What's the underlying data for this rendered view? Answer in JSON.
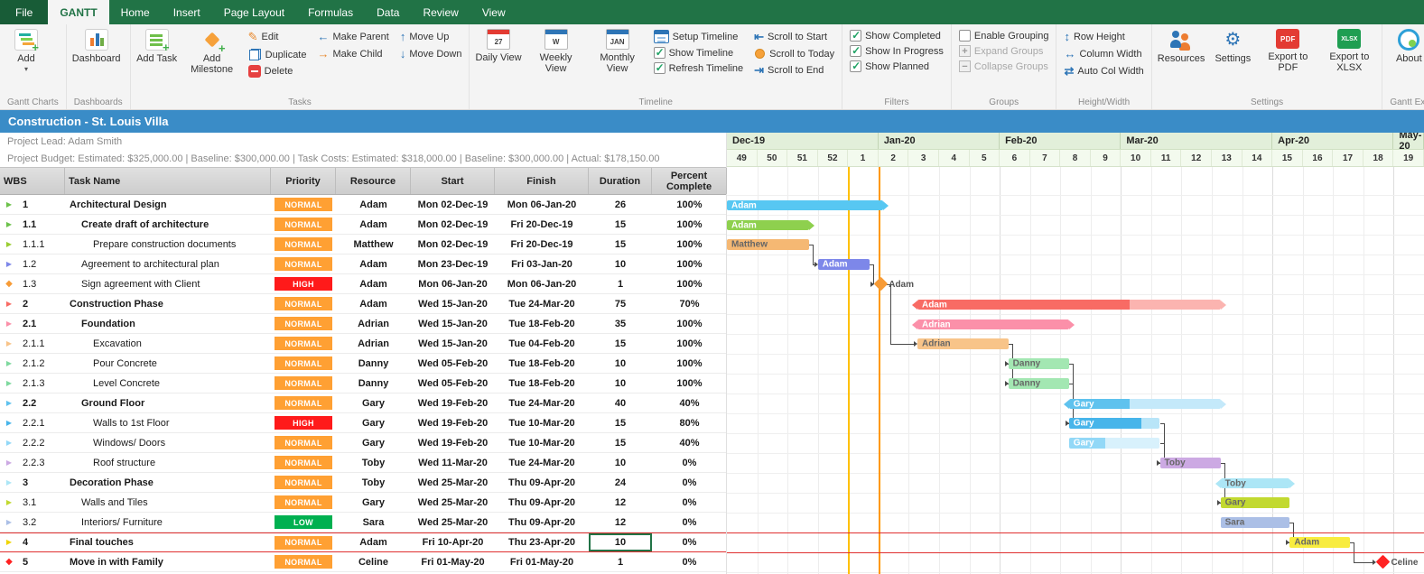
{
  "ribbon": {
    "tabs": [
      {
        "label": "File",
        "file": true
      },
      {
        "label": "GANTT",
        "active": true
      },
      {
        "label": "Home"
      },
      {
        "label": "Insert"
      },
      {
        "label": "Page Layout"
      },
      {
        "label": "Formulas"
      },
      {
        "label": "Data"
      },
      {
        "label": "Review"
      },
      {
        "label": "View"
      }
    ],
    "groups": [
      {
        "label": "Gantt Charts",
        "items": [
          {
            "type": "big",
            "label": "Add",
            "icon": "gantt-add",
            "dropdown": true
          }
        ]
      },
      {
        "label": "Dashboards",
        "items": [
          {
            "type": "big",
            "label": "Dashboard",
            "icon": "dashboard"
          }
        ]
      },
      {
        "label": "Tasks",
        "items": [
          {
            "type": "big",
            "label": "Add Task",
            "icon": "add-task"
          },
          {
            "type": "big",
            "label": "Add Milestone",
            "icon": "add-milestone"
          },
          {
            "type": "col",
            "items": [
              {
                "label": "Edit",
                "icon": "edit"
              },
              {
                "label": "Duplicate",
                "icon": "duplicate"
              },
              {
                "label": "Delete",
                "icon": "delete"
              }
            ]
          },
          {
            "type": "col",
            "items": [
              {
                "label": "Make Parent",
                "icon": "make-parent"
              },
              {
                "label": "Make Child",
                "icon": "make-child"
              }
            ]
          },
          {
            "type": "col",
            "items": [
              {
                "label": "Move Up",
                "icon": "move-up"
              },
              {
                "label": "Move Down",
                "icon": "move-down"
              }
            ]
          }
        ]
      },
      {
        "label": "Timeline",
        "items": [
          {
            "type": "big",
            "label": "Daily View",
            "icon": "cal-daily",
            "icon_text": "27"
          },
          {
            "type": "big",
            "label": "Weekly View",
            "icon": "cal-weekly",
            "icon_text": "W"
          },
          {
            "type": "big",
            "label": "Monthly View",
            "icon": "cal-monthly",
            "icon_text": "JAN"
          },
          {
            "type": "col",
            "items": [
              {
                "label": "Setup Timeline",
                "icon": "setup-timeline"
              },
              {
                "label": "Show Timeline",
                "icon": "check-on"
              },
              {
                "label": "Refresh Timeline",
                "icon": "check-on"
              }
            ]
          },
          {
            "type": "col",
            "items": [
              {
                "label": "Scroll to Start",
                "icon": "scroll-start"
              },
              {
                "label": "Scroll to Today",
                "icon": "scroll-today"
              },
              {
                "label": "Scroll to End",
                "icon": "scroll-end"
              }
            ]
          }
        ]
      },
      {
        "label": "Filters",
        "items": [
          {
            "type": "col",
            "items": [
              {
                "label": "Show Completed",
                "icon": "check-on"
              },
              {
                "label": "Show In Progress",
                "icon": "check-on"
              },
              {
                "label": "Show Planned",
                "icon": "check-on"
              }
            ]
          }
        ]
      },
      {
        "label": "Groups",
        "items": [
          {
            "type": "col",
            "items": [
              {
                "label": "Enable Grouping",
                "icon": "check-off"
              },
              {
                "label": "Expand Groups",
                "icon": "expand",
                "disabled": true
              },
              {
                "label": "Collapse Groups",
                "icon": "collapse",
                "disabled": true
              }
            ]
          }
        ]
      },
      {
        "label": "Height/Width",
        "items": [
          {
            "type": "col",
            "items": [
              {
                "label": "Row Height",
                "icon": "row-height"
              },
              {
                "label": "Column Width",
                "icon": "col-width"
              },
              {
                "label": "Auto Col Width",
                "icon": "auto-col"
              }
            ]
          }
        ]
      },
      {
        "label": "Settings",
        "items": [
          {
            "type": "big",
            "label": "Resources",
            "icon": "resources"
          },
          {
            "type": "big",
            "label": "Settings",
            "icon": "settings"
          },
          {
            "type": "big",
            "label": "Export to PDF",
            "icon": "pdf",
            "icon_text": "PDF"
          },
          {
            "type": "big",
            "label": "Export to XLSX",
            "icon": "xlsx",
            "icon_text": "XLSX"
          }
        ]
      },
      {
        "label": "Gantt Excel",
        "items": [
          {
            "type": "big",
            "label": "About",
            "icon": "about"
          }
        ]
      }
    ]
  },
  "titlebar": {
    "title": "Construction - St. Louis Villa"
  },
  "project": {
    "lead": "Project Lead: Adam Smith",
    "budget": "Project Budget: Estimated: $325,000.00 | Baseline: $300,000.00 | Task Costs: Estimated: $318,000.00 | Baseline: $300,000.00 | Actual: $178,150.00"
  },
  "table": {
    "headers": [
      "WBS",
      "Task Name",
      "Priority",
      "Resource",
      "Start",
      "Finish",
      "Duration",
      "Percent Complete"
    ],
    "priority_colors": {
      "NORMAL": "#FFA033",
      "HIGH": "#FF1A1A",
      "LOW": "#00B050"
    },
    "selected": {
      "row": 17,
      "field": "duration"
    },
    "rows": [
      {
        "wbs": "1",
        "name": "Architectural Design",
        "level": 1,
        "bold": true,
        "priority": "NORMAL",
        "resource": "Adam",
        "start": "Mon 02-Dec-19",
        "finish": "Mon 06-Jan-20",
        "duration": "26",
        "percent": "100%",
        "marker": {
          "shape": "arrow",
          "color": "#6DC24B"
        },
        "bar": {
          "type": "summary",
          "color": "#57C7F2",
          "start": "2019-12-02",
          "end": "2020-01-06",
          "label": "Adam",
          "label_color": "#ffffff"
        }
      },
      {
        "wbs": "1.1",
        "name": "Create draft of architecture",
        "level": 2,
        "bold": true,
        "priority": "NORMAL",
        "resource": "Adam",
        "start": "Mon 02-Dec-19",
        "finish": "Fri 20-Dec-19",
        "duration": "15",
        "percent": "100%",
        "marker": {
          "shape": "arrow",
          "color": "#6DC24B"
        },
        "bar": {
          "type": "summary",
          "color": "#8ED04E",
          "start": "2019-12-02",
          "end": "2019-12-20",
          "label": "Adam",
          "label_color": "#ffffff"
        }
      },
      {
        "wbs": "1.1.1",
        "name": "Prepare construction documents",
        "level": 3,
        "bold": false,
        "priority": "NORMAL",
        "resource": "Matthew",
        "start": "Mon 02-Dec-19",
        "finish": "Fri 20-Dec-19",
        "duration": "15",
        "percent": "100%",
        "marker": {
          "shape": "arrow",
          "color": "#9ACD32"
        },
        "bar": {
          "type": "task",
          "color": "#F5B873",
          "start": "2019-12-02",
          "end": "2019-12-20",
          "label": "Matthew",
          "label_color": "#666666"
        }
      },
      {
        "wbs": "1.2",
        "name": "Agreement to architectural plan",
        "level": 2,
        "bold": false,
        "priority": "NORMAL",
        "resource": "Adam",
        "start": "Mon 23-Dec-19",
        "finish": "Fri 03-Jan-20",
        "duration": "10",
        "percent": "100%",
        "marker": {
          "shape": "arrow",
          "color": "#7D87E9"
        },
        "bar": {
          "type": "task",
          "color": "#7D87E9",
          "start": "2019-12-23",
          "end": "2020-01-03",
          "label": "Adam",
          "label_color": "#ffffff"
        }
      },
      {
        "wbs": "1.3",
        "name": "Sign agreement with Client",
        "level": 2,
        "bold": false,
        "priority": "HIGH",
        "resource": "Adam",
        "start": "Mon 06-Jan-20",
        "finish": "Mon 06-Jan-20",
        "duration": "1",
        "percent": "100%",
        "marker": {
          "shape": "diamond",
          "color": "#F79B36"
        },
        "bar": {
          "type": "milestone",
          "color": "#F79B36",
          "date": "2020-01-06",
          "label": "Adam",
          "label_color": "#555555"
        }
      },
      {
        "wbs": "2",
        "name": "Construction Phase",
        "level": 1,
        "bold": true,
        "priority": "NORMAL",
        "resource": "Adam",
        "start": "Wed 15-Jan-20",
        "finish": "Tue 24-Mar-20",
        "duration": "75",
        "percent": "70%",
        "marker": {
          "shape": "arrow",
          "color": "#F86B64"
        },
        "bar": {
          "type": "summary",
          "color": "#F86B64",
          "light": "#FBB4B0",
          "pct": 70,
          "start": "2020-01-15",
          "end": "2020-03-24",
          "label": "Adam",
          "label_color": "#ffffff"
        }
      },
      {
        "wbs": "2.1",
        "name": "Foundation",
        "level": 2,
        "bold": true,
        "priority": "NORMAL",
        "resource": "Adrian",
        "start": "Wed 15-Jan-20",
        "finish": "Tue 18-Feb-20",
        "duration": "35",
        "percent": "100%",
        "marker": {
          "shape": "arrow",
          "color": "#FB90A9"
        },
        "bar": {
          "type": "summary",
          "color": "#FB90A9",
          "start": "2020-01-15",
          "end": "2020-02-18",
          "label": "Adrian",
          "label_color": "#ffffff"
        }
      },
      {
        "wbs": "2.1.1",
        "name": "Excavation",
        "level": 3,
        "bold": false,
        "priority": "NORMAL",
        "resource": "Adrian",
        "start": "Wed 15-Jan-20",
        "finish": "Tue 04-Feb-20",
        "duration": "15",
        "percent": "100%",
        "marker": {
          "shape": "arrow",
          "color": "#F8C489"
        },
        "bar": {
          "type": "task",
          "color": "#F8C489",
          "start": "2020-01-15",
          "end": "2020-02-04",
          "label": "Adrian",
          "label_color": "#666666"
        }
      },
      {
        "wbs": "2.1.2",
        "name": "Pour Concrete",
        "level": 3,
        "bold": false,
        "priority": "NORMAL",
        "resource": "Danny",
        "start": "Wed 05-Feb-20",
        "finish": "Tue 18-Feb-20",
        "duration": "10",
        "percent": "100%",
        "marker": {
          "shape": "arrow",
          "color": "#7FD99F"
        },
        "bar": {
          "type": "task",
          "color": "#A3E7B2",
          "start": "2020-02-05",
          "end": "2020-02-18",
          "label": "Danny",
          "label_color": "#666666"
        }
      },
      {
        "wbs": "2.1.3",
        "name": "Level Concrete",
        "level": 3,
        "bold": false,
        "priority": "NORMAL",
        "resource": "Danny",
        "start": "Wed 05-Feb-20",
        "finish": "Tue 18-Feb-20",
        "duration": "10",
        "percent": "100%",
        "marker": {
          "shape": "arrow",
          "color": "#7FD99F"
        },
        "bar": {
          "type": "task",
          "color": "#A3E7B2",
          "start": "2020-02-05",
          "end": "2020-02-18",
          "label": "Danny",
          "label_color": "#666666"
        }
      },
      {
        "wbs": "2.2",
        "name": "Ground Floor",
        "level": 2,
        "bold": true,
        "priority": "NORMAL",
        "resource": "Gary",
        "start": "Wed 19-Feb-20",
        "finish": "Tue 24-Mar-20",
        "duration": "40",
        "percent": "40%",
        "marker": {
          "shape": "arrow",
          "color": "#5FC2EE"
        },
        "bar": {
          "type": "summary",
          "color": "#5FC2EE",
          "light": "#C4E9FA",
          "pct": 40,
          "start": "2020-02-19",
          "end": "2020-03-24",
          "label": "Gary",
          "label_color": "#ffffff"
        }
      },
      {
        "wbs": "2.2.1",
        "name": "Walls to 1st Floor",
        "level": 3,
        "bold": false,
        "priority": "HIGH",
        "resource": "Gary",
        "start": "Wed 19-Feb-20",
        "finish": "Tue 10-Mar-20",
        "duration": "15",
        "percent": "80%",
        "marker": {
          "shape": "arrow",
          "color": "#47B5EA"
        },
        "bar": {
          "type": "task",
          "color": "#47B5EA",
          "light": "#B8E5F8",
          "pct": 80,
          "start": "2020-02-19",
          "end": "2020-03-10",
          "label": "Gary",
          "label_color": "#ffffff"
        }
      },
      {
        "wbs": "2.2.2",
        "name": "Windows/ Doors",
        "level": 3,
        "bold": false,
        "priority": "NORMAL",
        "resource": "Gary",
        "start": "Wed 19-Feb-20",
        "finish": "Tue 10-Mar-20",
        "duration": "15",
        "percent": "40%",
        "marker": {
          "shape": "arrow",
          "color": "#92D8F7"
        },
        "bar": {
          "type": "task",
          "color": "#92D8F7",
          "light": "#D8F1FC",
          "pct": 40,
          "start": "2020-02-19",
          "end": "2020-03-10",
          "label": "Gary",
          "label_color": "#ffffff"
        }
      },
      {
        "wbs": "2.2.3",
        "name": "Roof structure",
        "level": 3,
        "bold": false,
        "priority": "NORMAL",
        "resource": "Toby",
        "start": "Wed 11-Mar-20",
        "finish": "Tue 24-Mar-20",
        "duration": "10",
        "percent": "0%",
        "marker": {
          "shape": "arrow",
          "color": "#CCA9E3"
        },
        "bar": {
          "type": "task",
          "color": "#CCA9E3",
          "start": "2020-03-11",
          "end": "2020-03-24",
          "label": "Toby",
          "label_color": "#666666"
        }
      },
      {
        "wbs": "3",
        "name": "Decoration Phase",
        "level": 1,
        "bold": true,
        "priority": "NORMAL",
        "resource": "Toby",
        "start": "Wed 25-Mar-20",
        "finish": "Thu 09-Apr-20",
        "duration": "24",
        "percent": "0%",
        "marker": {
          "shape": "arrow",
          "color": "#ACE6F6"
        },
        "bar": {
          "type": "summary",
          "color": "#ACE6F6",
          "start": "2020-03-25",
          "end": "2020-04-09",
          "label": "Toby",
          "label_color": "#666666"
        }
      },
      {
        "wbs": "3.1",
        "name": "Walls and Tiles",
        "level": 2,
        "bold": false,
        "priority": "NORMAL",
        "resource": "Gary",
        "start": "Wed 25-Mar-20",
        "finish": "Thu 09-Apr-20",
        "duration": "12",
        "percent": "0%",
        "marker": {
          "shape": "arrow",
          "color": "#C2D930"
        },
        "bar": {
          "type": "task",
          "color": "#C2D930",
          "start": "2020-03-25",
          "end": "2020-04-09",
          "label": "Gary",
          "label_color": "#666666"
        }
      },
      {
        "wbs": "3.2",
        "name": "Interiors/ Furniture",
        "level": 2,
        "bold": false,
        "priority": "LOW",
        "resource": "Sara",
        "start": "Wed 25-Mar-20",
        "finish": "Thu 09-Apr-20",
        "duration": "12",
        "percent": "0%",
        "marker": {
          "shape": "arrow",
          "color": "#ABBFE6"
        },
        "bar": {
          "type": "task",
          "color": "#ABBFE6",
          "start": "2020-03-25",
          "end": "2020-04-09",
          "label": "Sara",
          "label_color": "#666666"
        }
      },
      {
        "wbs": "4",
        "name": "Final touches",
        "level": 1,
        "bold": true,
        "priority": "NORMAL",
        "resource": "Adam",
        "start": "Fri 10-Apr-20",
        "finish": "Thu 23-Apr-20",
        "duration": "10",
        "percent": "0%",
        "marker": {
          "shape": "arrow",
          "color": "#F0D500"
        },
        "bar": {
          "type": "task",
          "color": "#F8EC3F",
          "start": "2020-04-10",
          "end": "2020-04-23",
          "label": "Adam",
          "label_color": "#666666"
        }
      },
      {
        "wbs": "5",
        "name": "Move in with Family",
        "level": 1,
        "bold": true,
        "priority": "NORMAL",
        "resource": "Celine",
        "start": "Fri 01-May-20",
        "finish": "Fri 01-May-20",
        "duration": "1",
        "percent": "0%",
        "marker": {
          "shape": "diamond",
          "color": "#FF2222"
        },
        "bar": {
          "type": "milestone",
          "color": "#FF2222",
          "date": "2020-05-01",
          "label": "Celine",
          "label_color": "#555555"
        }
      }
    ]
  },
  "gantt": {
    "origin": "2019-12-02",
    "months": [
      {
        "label": "Dec-19",
        "weeks": [
          "49",
          "50",
          "51",
          "52",
          "1"
        ]
      },
      {
        "label": "Jan-20",
        "weeks": [
          "2",
          "3",
          "4",
          "5"
        ]
      },
      {
        "label": "Feb-20",
        "weeks": [
          "6",
          "7",
          "8",
          "9"
        ]
      },
      {
        "label": "Mar-20",
        "weeks": [
          "10",
          "11",
          "12",
          "13",
          "14"
        ]
      },
      {
        "label": "Apr-20",
        "weeks": [
          "15",
          "16",
          "17",
          "18"
        ]
      },
      {
        "label": "May-20",
        "weeks": [
          "19"
        ]
      }
    ],
    "vmarkers": [
      {
        "date": "2019-12-30",
        "color": "#FFC000"
      },
      {
        "date": "2020-01-06",
        "color": "#FF9800"
      }
    ],
    "connectors": [
      [
        2,
        3
      ],
      [
        3,
        4
      ],
      [
        4,
        7
      ],
      [
        7,
        8
      ],
      [
        7,
        9
      ],
      [
        8,
        11
      ],
      [
        9,
        11
      ],
      [
        11,
        13
      ],
      [
        12,
        13
      ],
      [
        13,
        15
      ],
      [
        16,
        17
      ],
      [
        17,
        18
      ]
    ],
    "red_row_index": 17
  }
}
